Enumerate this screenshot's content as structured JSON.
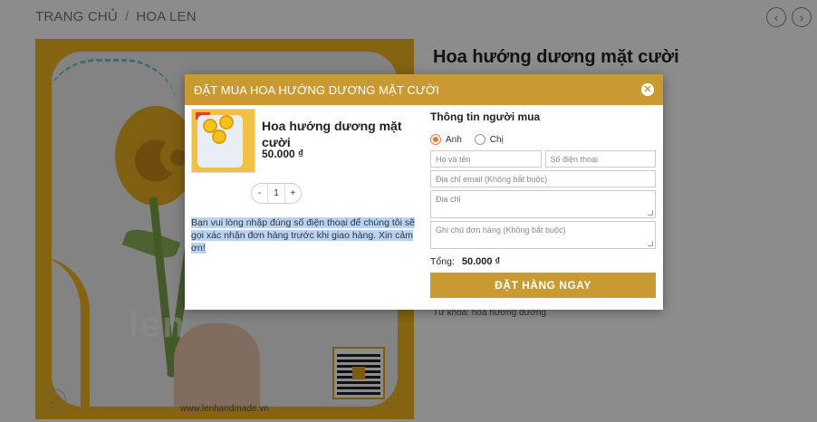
{
  "breadcrumb": {
    "home": "TRANG CHỦ",
    "separator": "/",
    "category": "HOA LEN"
  },
  "nav": {
    "prev_icon": "chevron-left-icon",
    "next_icon": "chevron-right-icon",
    "prev_glyph": "‹",
    "next_glyph": "›"
  },
  "product": {
    "title": "Hoa hướng dương mặt cười",
    "tags_label": "Từ khóa:",
    "tags_value": "hoa hướng dương",
    "image_watermark": "len",
    "image_site": "www.lenhandmade.vn",
    "zoom_glyph": "⤢"
  },
  "modal": {
    "title": "ĐẶT MUA HOA HƯỚNG DƯƠNG MẶT CƯỜI",
    "close_glyph": "✕",
    "item": {
      "name": "Hoa hướng dương mặt cười",
      "price": "50.000 ₫"
    },
    "quantity": {
      "minus": "-",
      "value": "1",
      "plus": "+"
    },
    "notice": "Bạn vui lòng nhập đúng số điện thoại để chúng tôi sẽ gọi xác nhận đơn hàng trước khi giao hàng. Xin cảm ơn!",
    "buyer": {
      "title": "Thông tin người mua",
      "gender_options": [
        "Anh",
        "Chị"
      ],
      "selected_gender": "Anh",
      "name_placeholder": "Họ và tên",
      "phone_placeholder": "Số điện thoại",
      "email_placeholder": "Địa chỉ email (Không bắt buộc)",
      "address_placeholder": "Địa chỉ",
      "note_placeholder": "Ghi chú đơn hàng (Không bắt buộc)"
    },
    "total_label": "Tổng:",
    "total_value": "50.000 ₫",
    "order_button": "ĐẶT HÀNG NGAY"
  },
  "colors": {
    "accent": "#c99a31",
    "radio_selected": "#e07a3c",
    "highlight": "#b8d4f5",
    "image_bg": "#f2b71f"
  }
}
